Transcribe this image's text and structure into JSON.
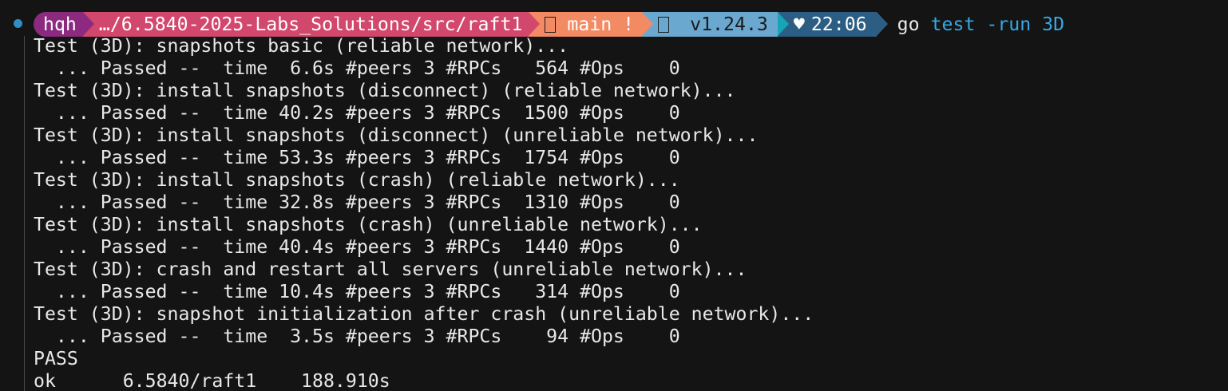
{
  "colors": {
    "background": "#141414",
    "text": "#e8e8e8",
    "status_dot": "#2f8ec4",
    "segment_user_bg": "#8b2a7e",
    "segment_path_bg": "#d2486c",
    "segment_git_bg": "#f28a64",
    "segment_go_bg": "#6ba8d0",
    "segment_go_fg": "#1a1a1a",
    "segment_go_arrow_tip": "#15a4b8",
    "segment_time_bg": "#2b5e82",
    "command_arg": "#35a9e6"
  },
  "prompt": {
    "user": "hqh",
    "path": "…/6.5840-2025-Labs_Solutions/src/raft1",
    "git_icon": "git-branch-icon",
    "git_branch": "main !",
    "go_icon": "go-language-icon",
    "go_version": "v1.24.3",
    "heart": "♥",
    "time": "22:06",
    "command": "go",
    "command_args": "test -run 3D"
  },
  "output_lines": [
    "Test (3D): snapshots basic (reliable network)...",
    "  ... Passed --  time  6.6s #peers 3 #RPCs   564 #Ops    0",
    "Test (3D): install snapshots (disconnect) (reliable network)...",
    "  ... Passed --  time 40.2s #peers 3 #RPCs  1500 #Ops    0",
    "Test (3D): install snapshots (disconnect) (unreliable network)...",
    "  ... Passed --  time 53.3s #peers 3 #RPCs  1754 #Ops    0",
    "Test (3D): install snapshots (crash) (reliable network)...",
    "  ... Passed --  time 32.8s #peers 3 #RPCs  1310 #Ops    0",
    "Test (3D): install snapshots (crash) (unreliable network)...",
    "  ... Passed --  time 40.4s #peers 3 #RPCs  1440 #Ops    0",
    "Test (3D): crash and restart all servers (unreliable network)...",
    "  ... Passed --  time 10.4s #peers 3 #RPCs   314 #Ops    0",
    "Test (3D): snapshot initialization after crash (unreliable network)...",
    "  ... Passed --  time  3.5s #peers 3 #RPCs    94 #Ops    0",
    "PASS",
    "ok  \t6.5840/raft1\t188.910s"
  ]
}
